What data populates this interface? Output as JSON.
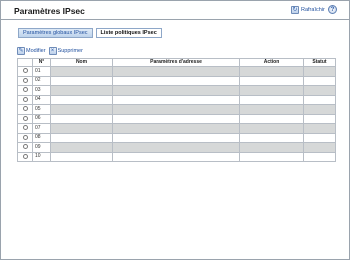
{
  "page": {
    "title": "Paramètres IPsec"
  },
  "header": {
    "refresh_label": "Rafraîchir",
    "help_icon": "?"
  },
  "tabs": [
    {
      "label": "Paramètres globaux IPsec",
      "active": false
    },
    {
      "label": "Liste politiques IPsec",
      "active": true
    }
  ],
  "toolbar": {
    "modify_label": "Modifier",
    "delete_label": "Supprimer"
  },
  "table": {
    "columns": [
      "",
      "N°",
      "Nom",
      "Paramètres d'adresse",
      "Action",
      "Statut"
    ],
    "rows": [
      {
        "num": "01"
      },
      {
        "num": "02"
      },
      {
        "num": "03"
      },
      {
        "num": "04"
      },
      {
        "num": "05"
      },
      {
        "num": "06"
      },
      {
        "num": "07"
      },
      {
        "num": "08"
      },
      {
        "num": "09"
      },
      {
        "num": "10"
      }
    ]
  },
  "colors": {
    "accent": "#1f4f9e",
    "stripe": "#d6d8d8",
    "border": "#b8bec6"
  }
}
